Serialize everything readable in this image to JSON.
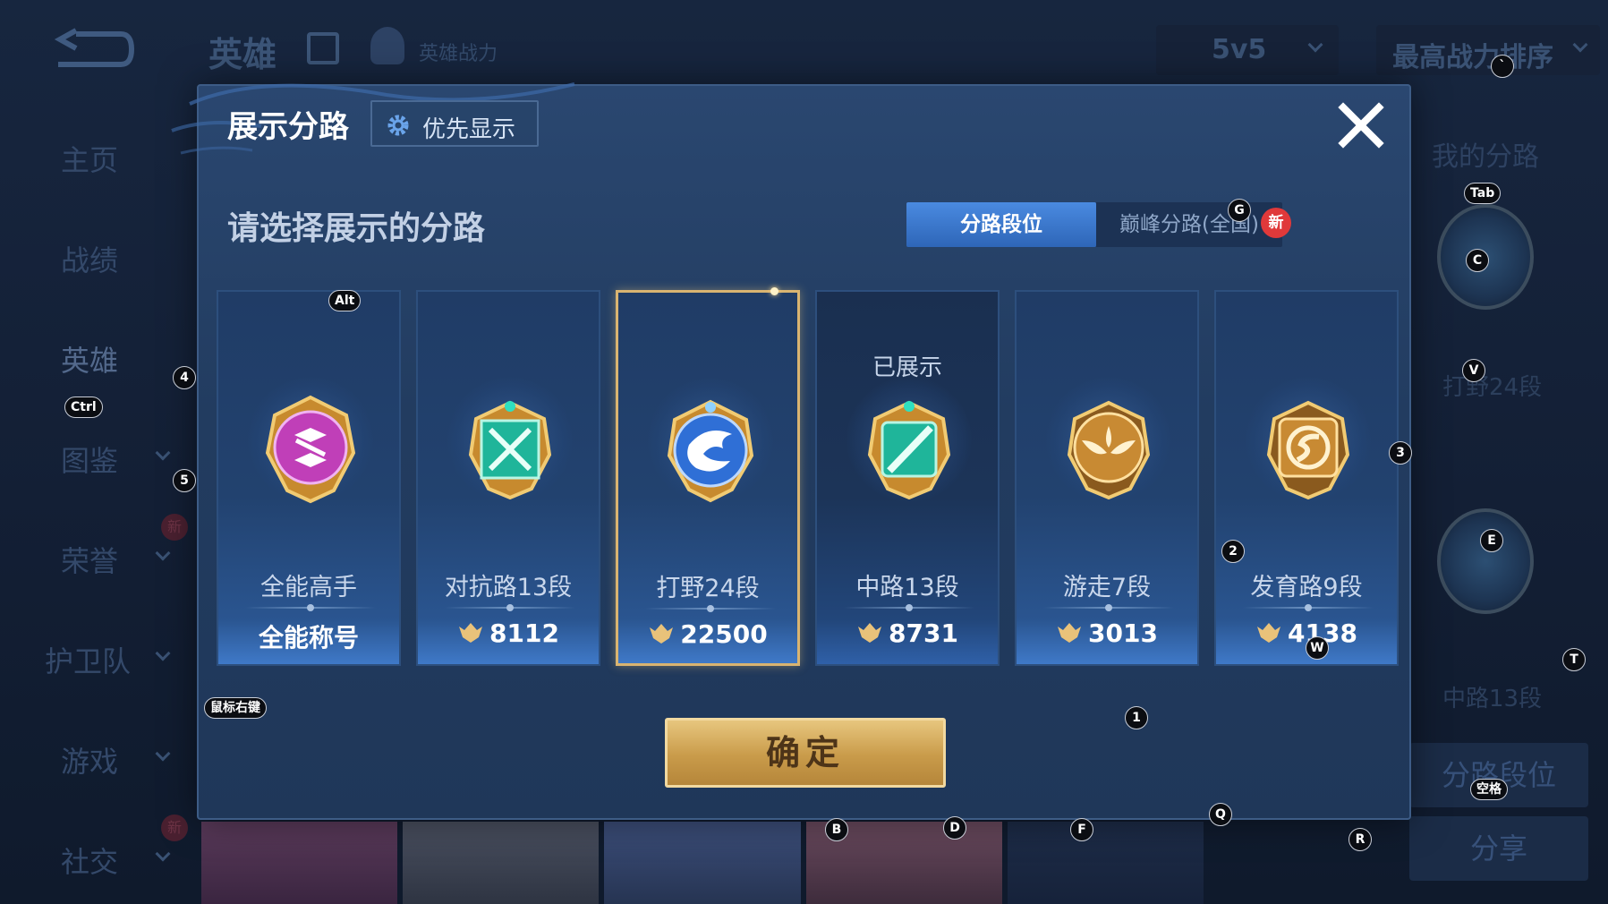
{
  "background": {
    "header_title": "英雄",
    "power_label": "英雄战力",
    "mode_select": "5v5",
    "sort_select": "最高战力排序",
    "sidebar": [
      {
        "label": "主页"
      },
      {
        "label": "战绩"
      },
      {
        "label": "英雄"
      },
      {
        "label": "图鉴"
      },
      {
        "label": "荣誉",
        "badge": "新"
      },
      {
        "label": "护卫队"
      },
      {
        "label": "游戏"
      },
      {
        "label": "社交",
        "badge": "新"
      }
    ],
    "right_panel": {
      "title": "我的分路",
      "lane1": "打野24段",
      "lane2": "中路13段",
      "tab_button": "分路段位",
      "share_button": "分享"
    }
  },
  "modal": {
    "title": "展示分路",
    "priority_button": "优先显示",
    "subtitle": "请选择展示的分路",
    "tabs": [
      "分路段位",
      "巅峰分路(全国)"
    ],
    "new_badge": "新",
    "confirm_button": "确定",
    "cards": [
      {
        "rank": "全能高手",
        "score": "全能称号",
        "shown_label": "",
        "emblem_color": "#c03fb8"
      },
      {
        "rank": "对抗路13段",
        "score": "8112",
        "shown_label": "",
        "emblem_color": "#1fb59a"
      },
      {
        "rank": "打野24段",
        "score": "22500",
        "shown_label": "",
        "emblem_color": "#2f6fd6"
      },
      {
        "rank": "中路13段",
        "score": "8731",
        "shown_label": "已展示",
        "emblem_color": "#1fb59a"
      },
      {
        "rank": "游走7段",
        "score": "3013",
        "shown_label": "",
        "emblem_color": "#c88a33"
      },
      {
        "rank": "发育路9段",
        "score": "4138",
        "shown_label": "",
        "emblem_color": "#c88a33"
      }
    ]
  },
  "key_hints": [
    "`",
    "Tab",
    "C",
    "V",
    "3",
    "E",
    "T",
    "W",
    "2",
    "1",
    "Q",
    "R",
    "F",
    "D",
    "B",
    "G",
    "Alt",
    "4",
    "Ctrl",
    "5",
    "鼠标右键",
    "空格"
  ]
}
